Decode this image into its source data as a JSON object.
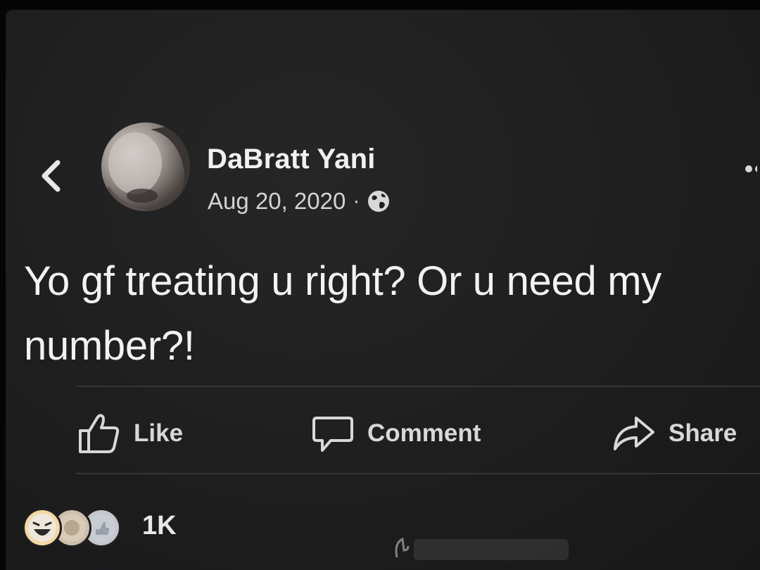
{
  "post": {
    "author": "DaBratt Yani",
    "date": "Aug 20, 2020",
    "separator": "·",
    "privacy_icon": "globe-icon",
    "text": "Yo gf treating u right? Or u need my number?!"
  },
  "actions": {
    "like_label": "Like",
    "comment_label": "Comment",
    "share_label": "Share"
  },
  "reactions": {
    "icons": [
      "haha-icon",
      "reaction-icon",
      "reaction-icon"
    ],
    "count": "1K"
  },
  "navigation": {
    "back_icon": "chevron-left-icon",
    "more_icon": "more-options-icon"
  },
  "colors": {
    "background": "#1e1e1f",
    "text": "#f2f2f2",
    "secondary_text": "#d4d4d4"
  }
}
